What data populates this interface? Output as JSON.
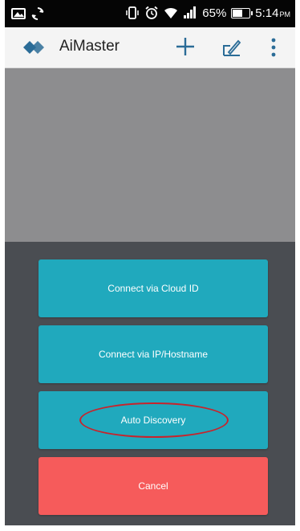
{
  "status_bar": {
    "battery_percent": "65%",
    "battery_level": 0.65,
    "time": "5:14",
    "time_suffix": "PM",
    "icons": [
      "photo-notification-icon",
      "sync-icon",
      "vibrate-icon",
      "alarm-icon",
      "wifi-icon",
      "signal-icon",
      "battery-icon"
    ]
  },
  "app_bar": {
    "title": "AiMaster",
    "icons": [
      "aimaster-logo-icon",
      "plus-icon",
      "edit-icon",
      "more-vert-icon"
    ],
    "accent_color": "#2b6c97"
  },
  "dialog": {
    "buttons": {
      "cloud_id": "Connect via Cloud ID",
      "ip_hostname": "Connect via IP/Hostname",
      "auto_discovery": "Auto Discovery",
      "cancel": "Cancel"
    },
    "colors": {
      "primary_button": "#20a9bd",
      "cancel_button": "#f65b5b",
      "sheet_background": "#4a4d52",
      "highlight_ring": "#c8232b"
    }
  }
}
